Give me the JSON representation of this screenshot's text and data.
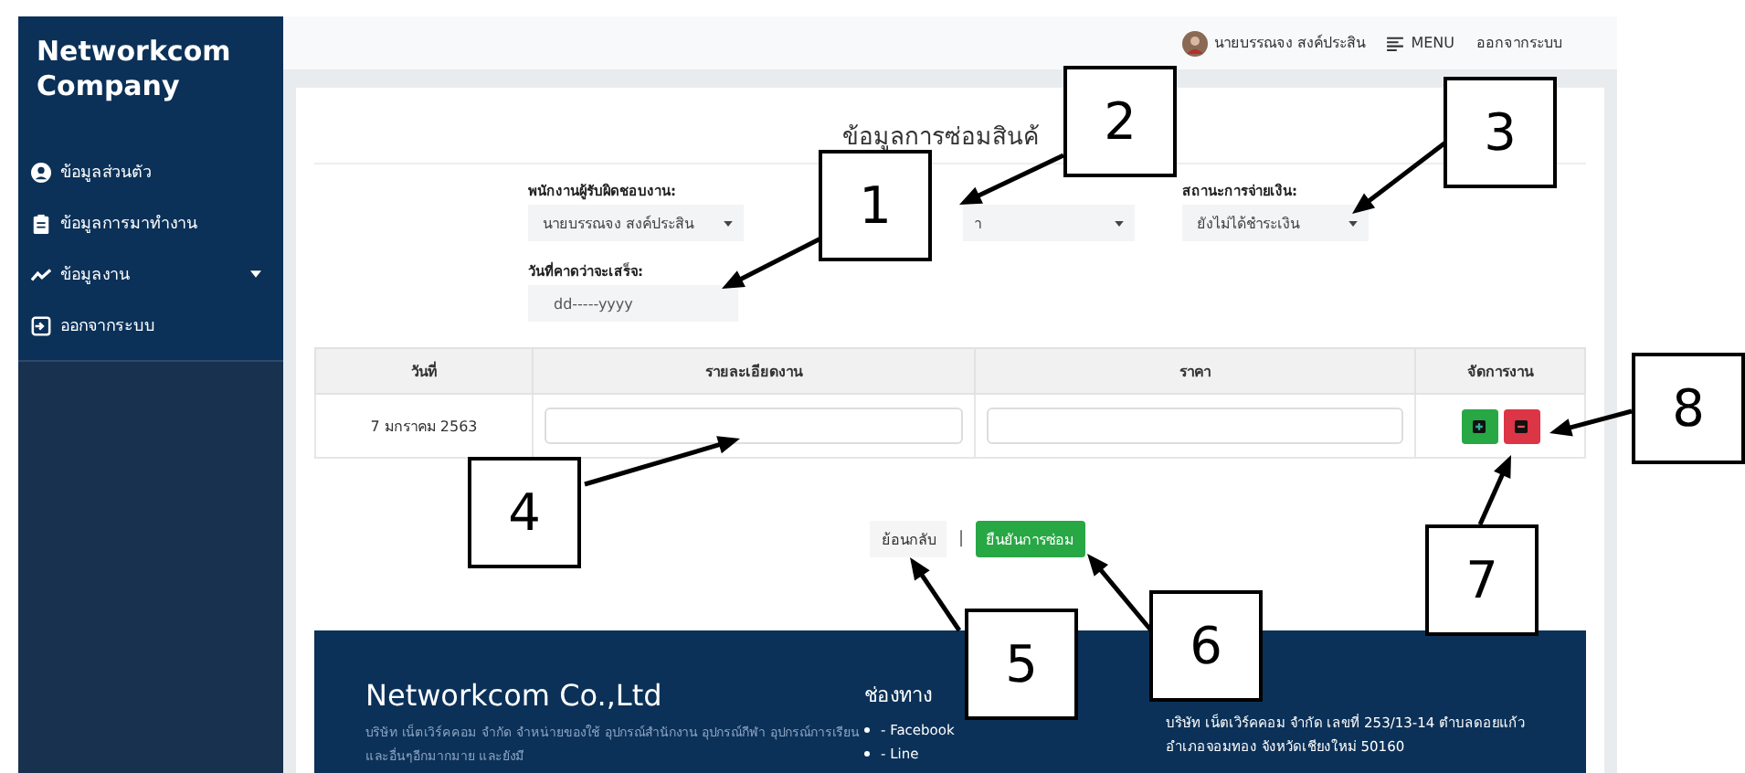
{
  "sidebar": {
    "brand": [
      "Networkcom",
      "Company"
    ],
    "items": [
      {
        "label": "ข้อมูลส่วนตัว",
        "kind": "user",
        "expandable": false
      },
      {
        "label": "ข้อมูลการมาทำงาน",
        "kind": "clipboard",
        "expandable": false
      },
      {
        "label": "ข้อมูลงาน",
        "kind": "chart",
        "expandable": true
      },
      {
        "label": "ออกจากระบบ",
        "kind": "signout",
        "expandable": false
      }
    ]
  },
  "topbar": {
    "user_name": "นายบรรณจง สงค์ประสิน",
    "menu": "MENU",
    "logout": "ออกจากระบบ"
  },
  "form": {
    "title": "ข้อมูลการซ่อมสินค้",
    "fields": [
      {
        "label": "พนักงานผู้รับผิดชอบงาน:",
        "value": "นายบรรณจง สงค์ประสิน"
      },
      {
        "value": "า"
      },
      {
        "label": "สถานะการจ่ายเงิน:",
        "value": "ยังไม่ได้ชำระเงิน"
      }
    ],
    "due_date": {
      "label": "วันที่คาดว่าจะเสร็จ:",
      "placeholder": "dd-----yyyy"
    }
  },
  "table": {
    "columns": [
      "วันที่",
      "รายละเอียดงาน",
      "ราคา",
      "จัดการงาน"
    ],
    "rows": [
      {
        "date": "7 มกราคม 2563"
      }
    ]
  },
  "actions": {
    "back": "ย้อนกลับ",
    "separator": "|",
    "confirm": "ยืนยันการซ่อม"
  },
  "footer": {
    "title": "Networkcom Co.,Ltd",
    "about": "บริษัท เน็ตเวิร์คคอม จำกัด จำหน่ายของใช้ อุปกรณ์สำนักงาน อุปกรณ์กีฬา อุปกรณ์การเรียน และอื่นๆอีกมากมาย และยังมี",
    "channels_title": "ช่องทาง",
    "channels": [
      "- Facebook",
      "- Line"
    ],
    "address": "บริษัท เน็ตเวิร์คคอม จำกัด เลขที่ 253/13-14 ตำบลดอยแก้ว อำเภอจอมทอง จังหวัดเชียงใหม่ 50160"
  },
  "callouts": [
    "1",
    "2",
    "3",
    "4",
    "5",
    "6",
    "7",
    "8"
  ]
}
